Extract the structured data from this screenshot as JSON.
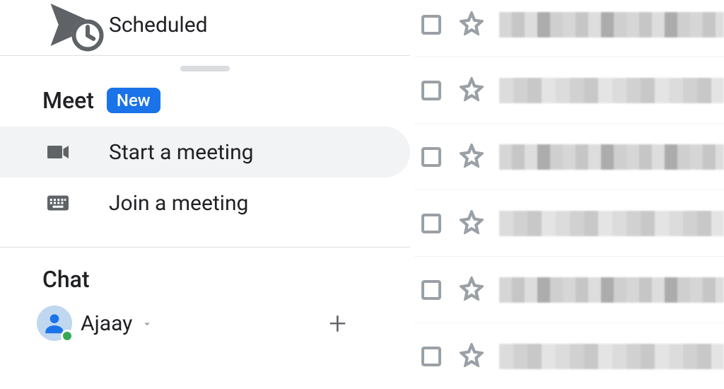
{
  "sidebar": {
    "scheduled_label": "Scheduled",
    "meet": {
      "title": "Meet",
      "badge": "New",
      "start_label": "Start a meeting",
      "join_label": "Join a meeting"
    },
    "chat": {
      "title": "Chat",
      "user_name": "Ajaay"
    }
  }
}
